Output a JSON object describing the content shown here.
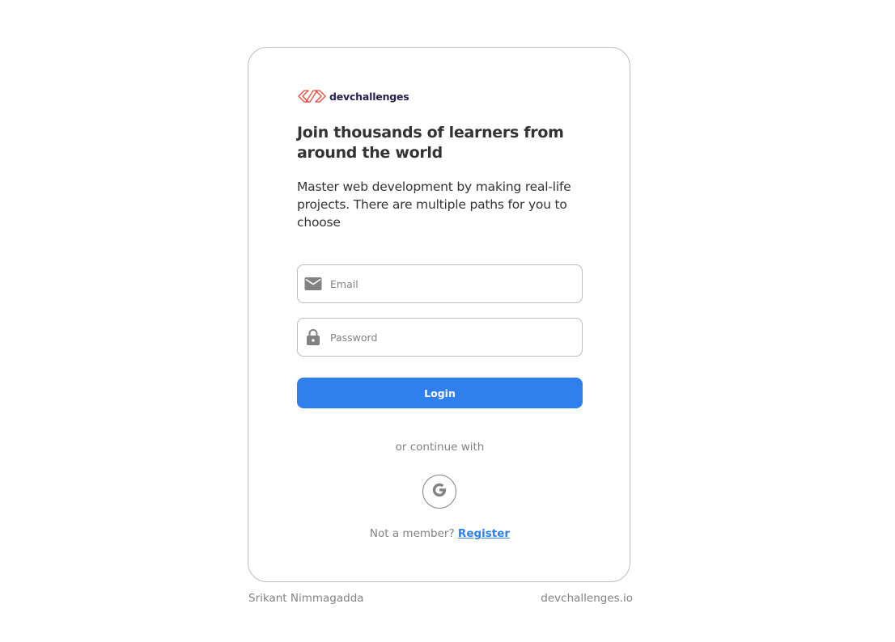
{
  "brand": {
    "name": "devchallenges",
    "logo_icon": "devchallenges-logo-icon",
    "logo_color": "#e64a3b"
  },
  "headline": "Join thousands of learners from around the world",
  "subtitle": "Master web development by making real-life projects. There are multiple paths for you to choose",
  "form": {
    "email": {
      "icon": "mail-icon",
      "placeholder": "Email",
      "value": ""
    },
    "password": {
      "icon": "lock-icon",
      "placeholder": "Password",
      "value": ""
    },
    "login_label": "Login"
  },
  "social": {
    "continue_text": "or continue with",
    "providers": [
      {
        "name": "google",
        "icon": "google-icon"
      }
    ]
  },
  "register": {
    "prompt": "Not a member?",
    "link_label": "Register"
  },
  "footer": {
    "author": "Srikant Nimmagadda",
    "site": "devchallenges.io"
  },
  "colors": {
    "primary": "#2f80ed",
    "text": "#333333",
    "muted": "#828282",
    "border": "#bdbdbd"
  }
}
